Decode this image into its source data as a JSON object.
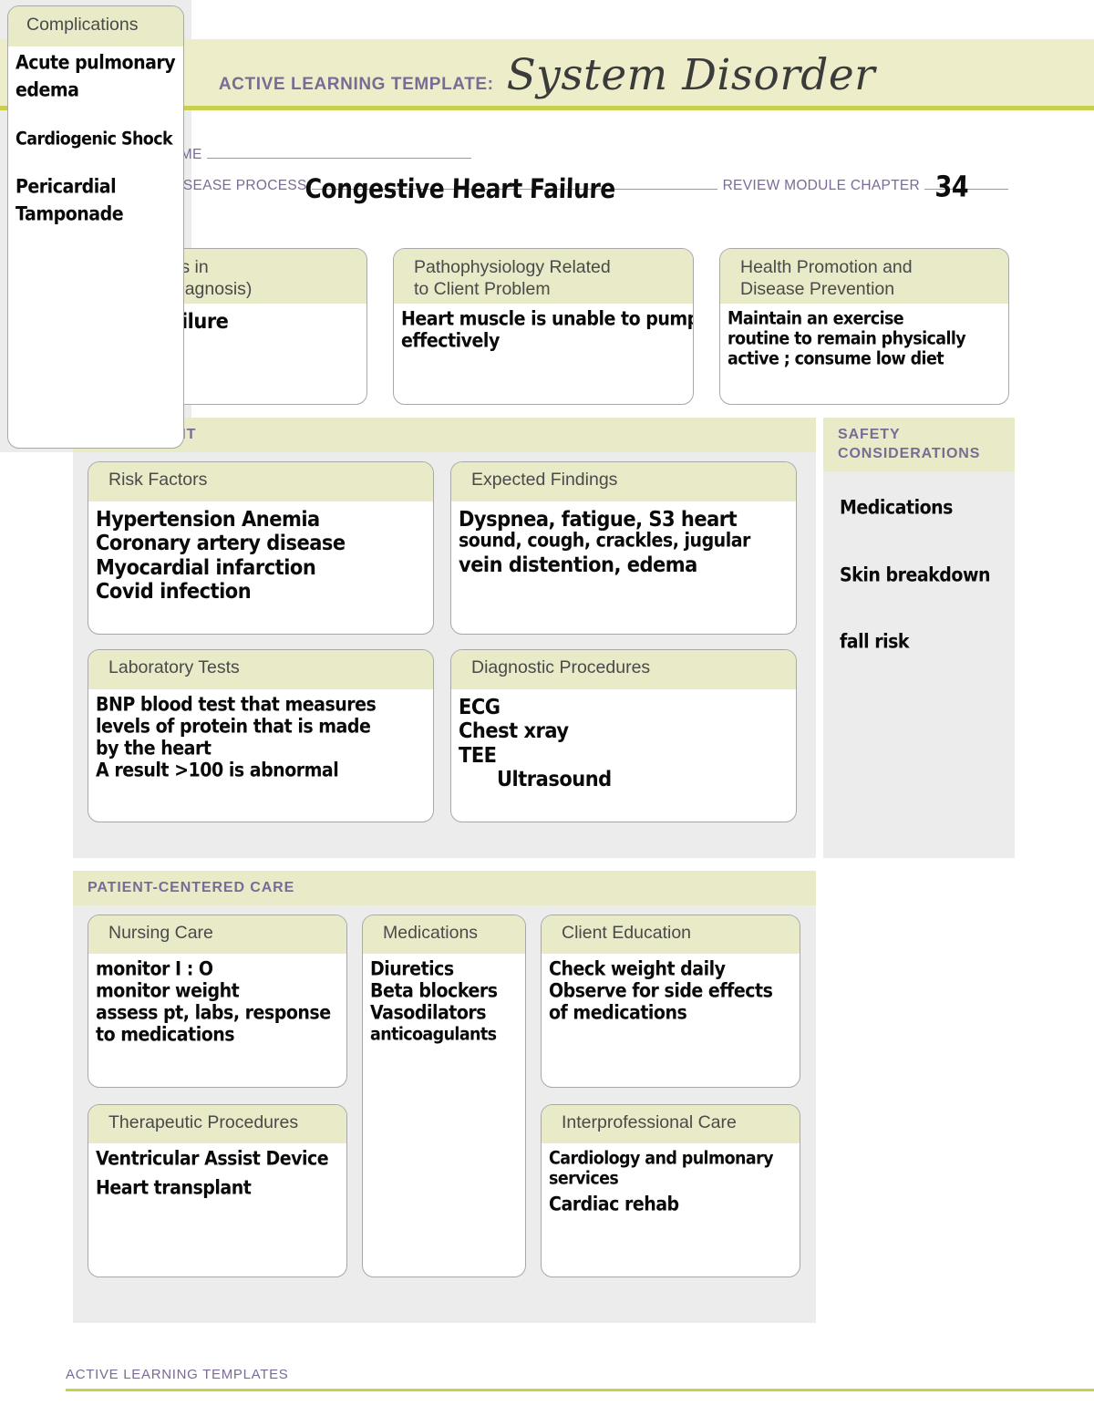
{
  "header": {
    "kicker": "ACTIVE LEARNING TEMPLATE:",
    "title": "System Disorder"
  },
  "identity": {
    "student_name_label": "STUDENT NAME",
    "student_name_value": "",
    "disorder_label": "DISORDER/DISEASE PROCESS",
    "disorder_value": "Congestive  Heart Failure",
    "chapter_label": "REVIEW MODULE CHAPTER",
    "chapter_value": "34"
  },
  "top_boxes": [
    {
      "title": "Alterations in\nHealth (Diagnosis)",
      "lines": [
        "Heart Failure"
      ]
    },
    {
      "title": "Pathophysiology Related\nto Client Problem",
      "lines": [
        "Heart muscle is unable to pump",
        "effectively"
      ]
    },
    {
      "title": "Health Promotion and\nDisease Prevention",
      "lines": [
        "Maintain an exercise",
        "routine to remain physically",
        "active ; consume low diet"
      ]
    }
  ],
  "assessment": {
    "panel_title": "ASSESSMENT",
    "cards": [
      {
        "title": "Risk Factors",
        "lines": [
          "Hypertension      Anemia",
          "Coronary artery disease",
          "Myocardial infarction",
          "Covid      infection"
        ]
      },
      {
        "title": "Expected Findings",
        "lines": [
          "Dyspnea, fatigue, S3 heart",
          "sound, cough, crackles, jugular",
          "vein distention, edema"
        ]
      },
      {
        "title": "Laboratory Tests",
        "lines": [
          "BNP  blood test that measures",
          "levels of protein that is made",
          "by the heart",
          "A  result >100 is abnormal"
        ]
      },
      {
        "title": "Diagnostic Procedures",
        "lines": [
          "ECG",
          "Chest xray",
          "TEE",
          "Ultrasound"
        ]
      }
    ]
  },
  "safety": {
    "panel_title": "SAFETY\nCONSIDERATIONS",
    "items": [
      "Medications",
      "Skin breakdown",
      "fall risk"
    ]
  },
  "patient_centered_care": {
    "panel_title": "PATIENT-CENTERED CARE",
    "cards": [
      {
        "title": "Nursing Care",
        "lines": [
          "monitor I : O",
          "monitor weight",
          "assess pt, labs, response",
          "to medications"
        ]
      },
      {
        "title": "Medications",
        "lines": [
          "Diuretics",
          "Beta blockers",
          "Vasodilators",
          "anticoagulants"
        ]
      },
      {
        "title": "Client Education",
        "lines": [
          "Check weight daily",
          "Observe for side effects",
          "of medications"
        ]
      },
      {
        "title": "Therapeutic Procedures",
        "lines": [
          "Ventricular Assist Device",
          "Heart transplant"
        ]
      },
      {
        "title": "Interprofessional Care",
        "lines": [
          "Cardiology and pulmonary",
          "services",
          "Cardiac rehab"
        ]
      }
    ]
  },
  "complications": {
    "title": "Complications",
    "groups": [
      [
        "Acute pulmonary",
        " edema"
      ],
      [
        "Cardiogenic Shock"
      ],
      [
        "Pericardial",
        "Tamponade"
      ]
    ]
  },
  "footer": {
    "text": "ACTIVE LEARNING TEMPLATES"
  },
  "colors": {
    "banner_bg": "#edeec9",
    "accent_rule": "#c8ce4e",
    "label_purple": "#7a6b96",
    "card_head": "#e9eac8",
    "panel_bg": "#ececec"
  }
}
